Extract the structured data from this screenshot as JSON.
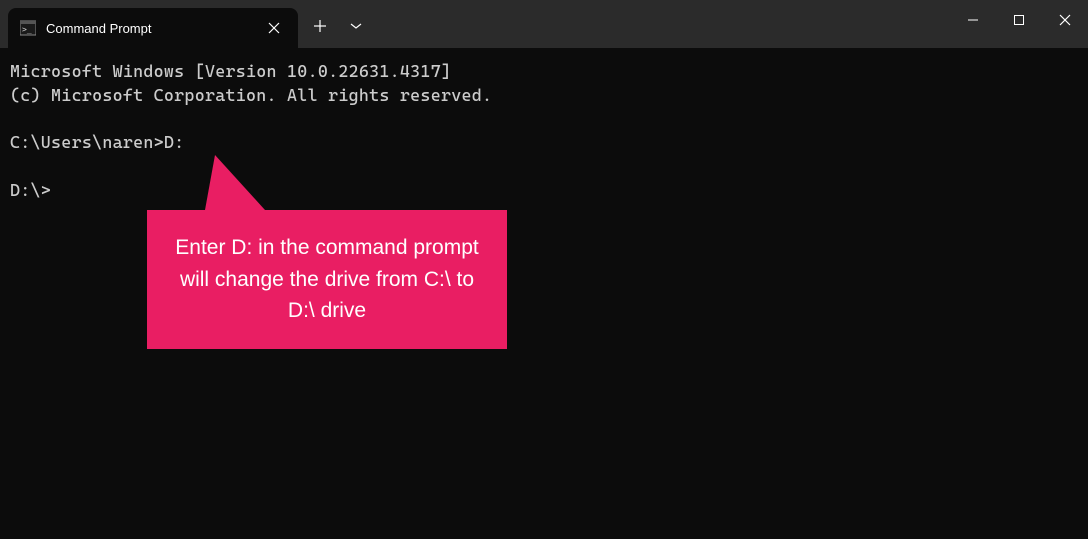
{
  "titlebar": {
    "tab_title": "Command Prompt"
  },
  "terminal": {
    "line1": "Microsoft Windows [Version 10.0.22631.4317]",
    "line2": "(c) Microsoft Corporation. All rights reserved.",
    "blank1": "",
    "prompt1_path": "C:\\Users\\naren>",
    "prompt1_input": "D:",
    "blank2": "",
    "prompt2": "D:\\>"
  },
  "annotation": {
    "text": "Enter D: in the command prompt will change the drive from C:\\ to D:\\ drive"
  }
}
